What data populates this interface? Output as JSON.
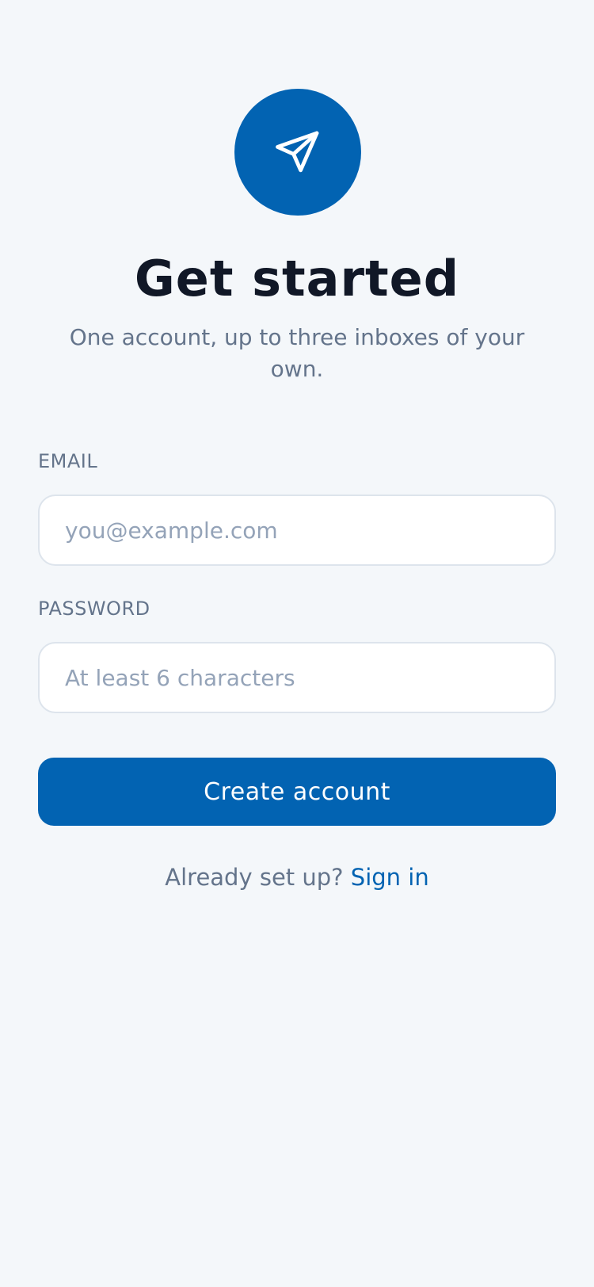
{
  "brand": {
    "icon": "paper-plane-icon",
    "accent_color": "#0263b2"
  },
  "header": {
    "title": "Get started",
    "subtitle": "One account, up to three inboxes of your own."
  },
  "form": {
    "email": {
      "label": "EMAIL",
      "placeholder": "you@example.com",
      "value": ""
    },
    "password": {
      "label": "PASSWORD",
      "placeholder": "At least 6 characters",
      "value": ""
    },
    "submit_label": "Create account"
  },
  "footer": {
    "prompt": "Already set up?",
    "link_label": "Sign in"
  }
}
